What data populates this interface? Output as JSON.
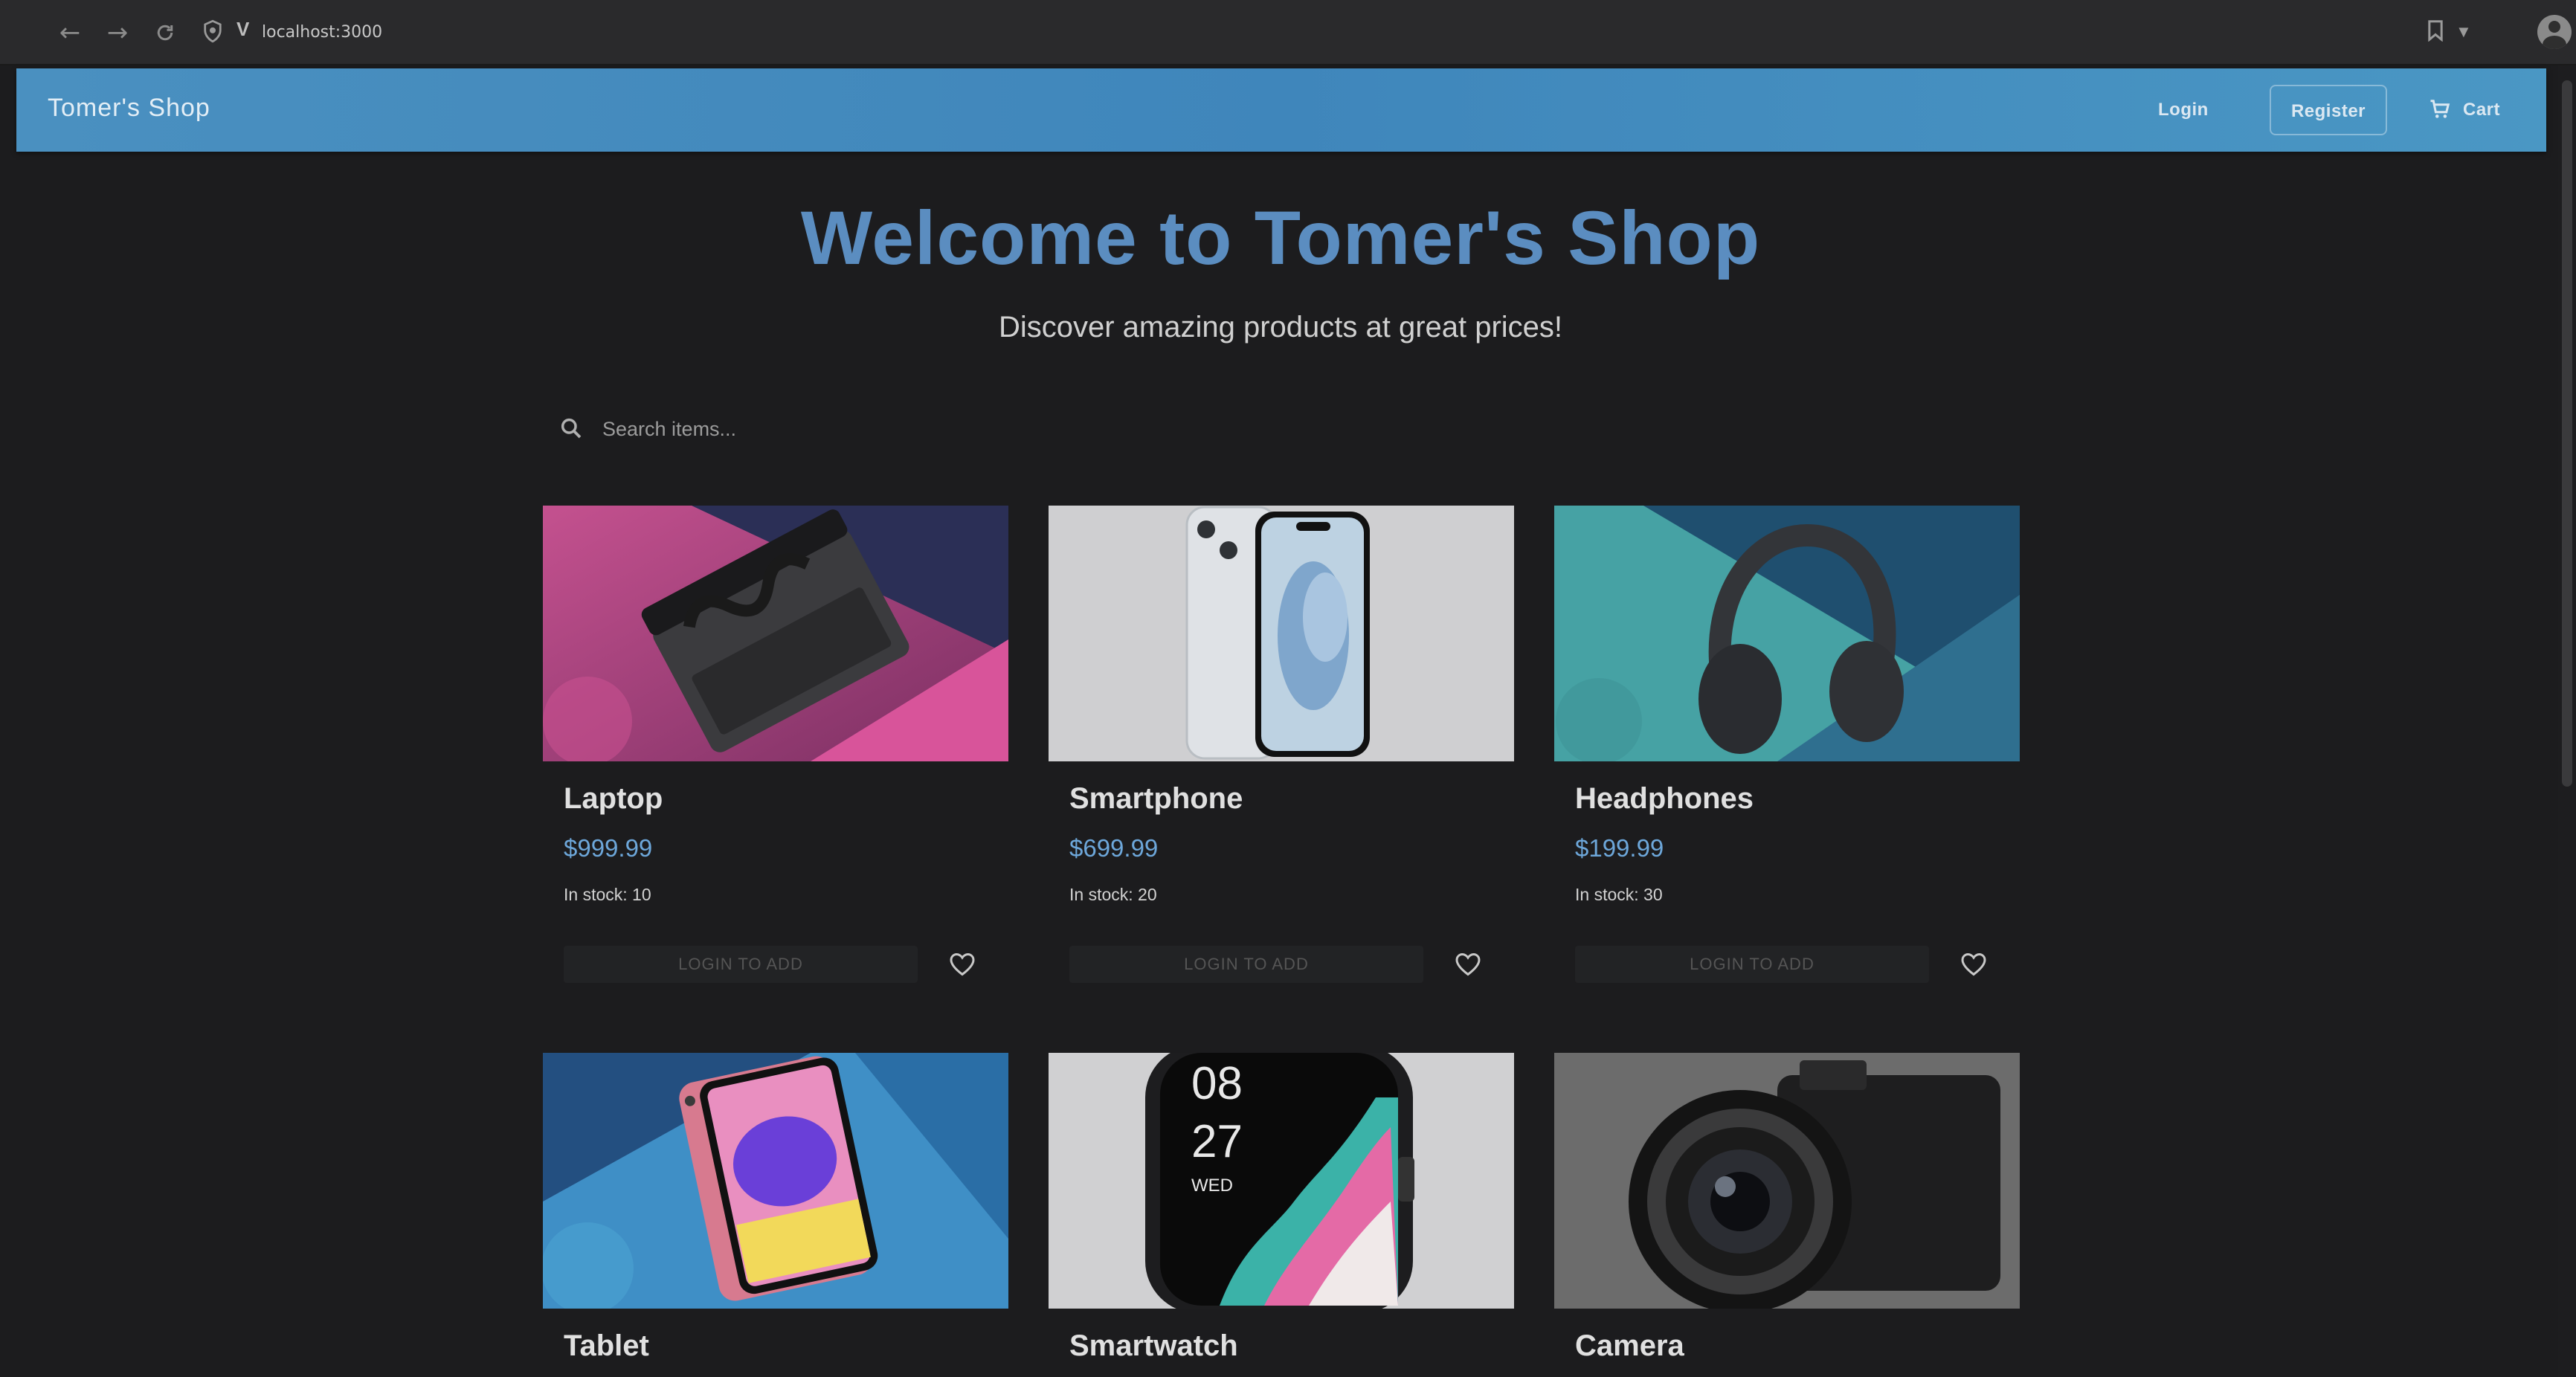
{
  "browser": {
    "url": "localhost:3000",
    "icons": [
      "back-arrow-icon",
      "forward-arrow-icon",
      "reload-icon",
      "shield-icon",
      "vivaldi-logo-icon",
      "bookmark-icon",
      "chevron-down-icon",
      "profile-avatar-icon"
    ]
  },
  "header": {
    "brand": "Tomer's Shop",
    "login_label": "Login",
    "register_label": "Register",
    "cart_label": "Cart",
    "background_color": "#4a90c0"
  },
  "hero": {
    "title": "Welcome to Tomer's Shop",
    "subtitle": "Discover amazing products at great prices!",
    "title_color": "#5b8dc0"
  },
  "search": {
    "placeholder": "Search items..."
  },
  "products": [
    {
      "name": "Laptop",
      "price": "$999.99",
      "stock": "In stock: 10",
      "button": "LOGIN TO ADD"
    },
    {
      "name": "Smartphone",
      "price": "$699.99",
      "stock": "In stock: 20",
      "button": "LOGIN TO ADD"
    },
    {
      "name": "Headphones",
      "price": "$199.99",
      "stock": "In stock: 30",
      "button": "LOGIN TO ADD"
    },
    {
      "name": "Tablet"
    },
    {
      "name": "Smartwatch",
      "watch_hour": "08",
      "watch_minute": "27",
      "watch_day": "WED"
    },
    {
      "name": "Camera"
    }
  ],
  "colors": {
    "page_background": "#1c1c1e",
    "price": "#6da7da"
  }
}
